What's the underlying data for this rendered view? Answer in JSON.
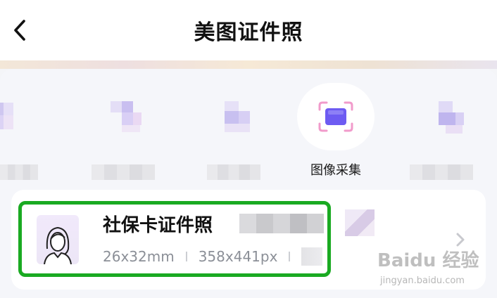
{
  "header": {
    "title": "美图证件照",
    "back_icon": "chevron-left-icon"
  },
  "tools": [
    {
      "label": "",
      "blurred": true
    },
    {
      "label": "",
      "blurred": true
    },
    {
      "label": "",
      "blurred": true
    },
    {
      "label": "图像采集",
      "blurred": false,
      "icon": "capture-frame-icon",
      "accent": "#6d5bf2"
    },
    {
      "label": "",
      "blurred": true
    }
  ],
  "list_item": {
    "title": "社保卡证件照",
    "size_mm": "26x32mm",
    "size_px": "358x441px",
    "highlight_color": "#1aaa22",
    "avatar_icon": "person-portrait-icon",
    "chevron_icon": "chevron-right-icon"
  },
  "watermark": {
    "text": "Baidu 经验",
    "sub": "jingyan.baidu.com"
  }
}
